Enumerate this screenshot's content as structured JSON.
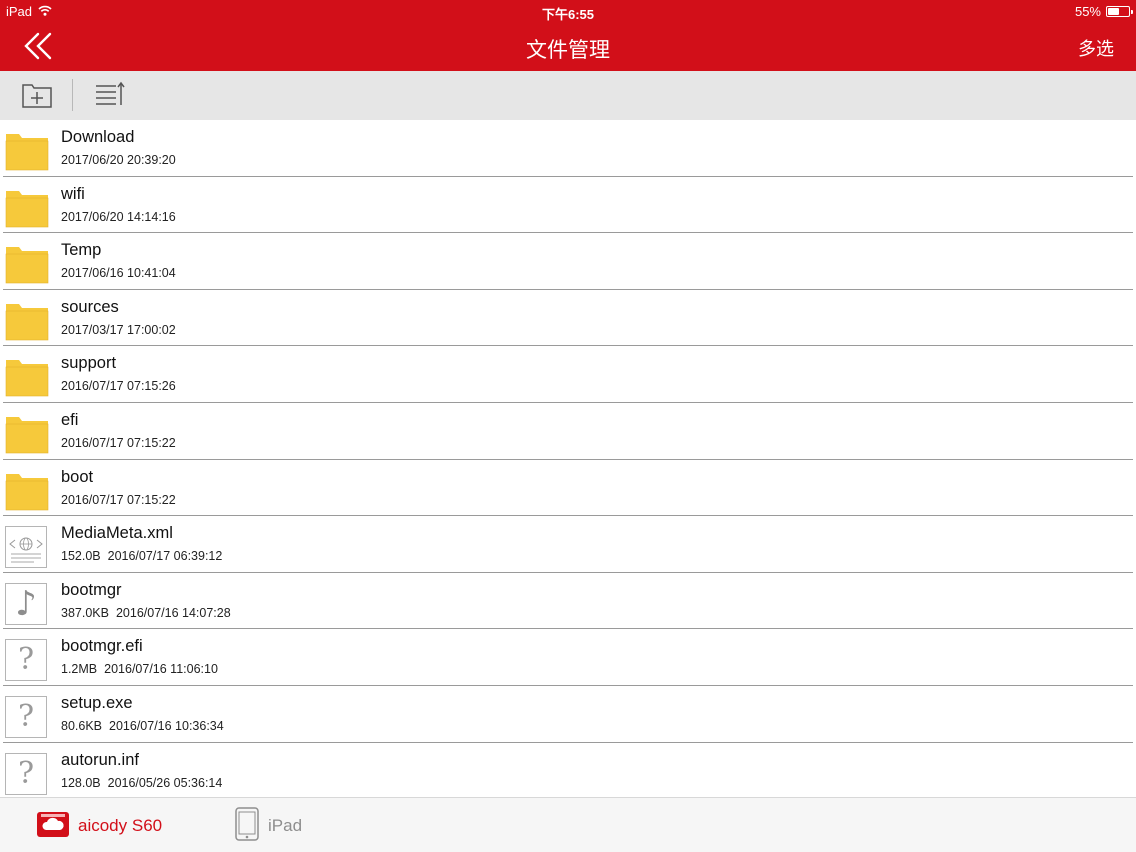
{
  "status_bar": {
    "device": "iPad",
    "time": "下午6:55",
    "battery": "55%",
    "battery_level": 0.55
  },
  "nav": {
    "title": "文件管理",
    "multi_select": "多选"
  },
  "colors": {
    "header": "#d20f19",
    "folder": "#f6c93b",
    "active_tab": "#d20f19",
    "inactive_tab": "#8e8e8e"
  },
  "files": [
    {
      "name": "Download",
      "size": "",
      "date": "2017/06/20 20:39:20",
      "icon": "folder-icon"
    },
    {
      "name": "wifi",
      "size": "",
      "date": "2017/06/20 14:14:16",
      "icon": "folder-icon"
    },
    {
      "name": "Temp",
      "size": "",
      "date": "2017/06/16 10:41:04",
      "icon": "folder-icon"
    },
    {
      "name": "sources",
      "size": "",
      "date": "2017/03/17 17:00:02",
      "icon": "folder-icon"
    },
    {
      "name": "support",
      "size": "",
      "date": "2016/07/17 07:15:26",
      "icon": "folder-icon"
    },
    {
      "name": "efi",
      "size": "",
      "date": "2016/07/17 07:15:22",
      "icon": "folder-icon"
    },
    {
      "name": "boot",
      "size": "",
      "date": "2016/07/17 07:15:22",
      "icon": "folder-icon"
    },
    {
      "name": "MediaMeta.xml",
      "size": "152.0B",
      "date": "2016/07/17 06:39:12",
      "icon": "web-file-icon"
    },
    {
      "name": "bootmgr",
      "size": "387.0KB",
      "date": "2016/07/16 14:07:28",
      "icon": "music-file-icon"
    },
    {
      "name": "bootmgr.efi",
      "size": "1.2MB",
      "date": "2016/07/16 11:06:10",
      "icon": "unknown-file-icon"
    },
    {
      "name": "setup.exe",
      "size": "80.6KB",
      "date": "2016/07/16 10:36:34",
      "icon": "unknown-file-icon"
    },
    {
      "name": "autorun.inf",
      "size": "128.0B",
      "date": "2016/05/26 05:36:14",
      "icon": "unknown-file-icon"
    }
  ],
  "tabs": [
    {
      "label": "aicody S60",
      "icon": "cloud-drive-icon",
      "active": true
    },
    {
      "label": "iPad",
      "icon": "ipad-device-icon",
      "active": false
    }
  ]
}
